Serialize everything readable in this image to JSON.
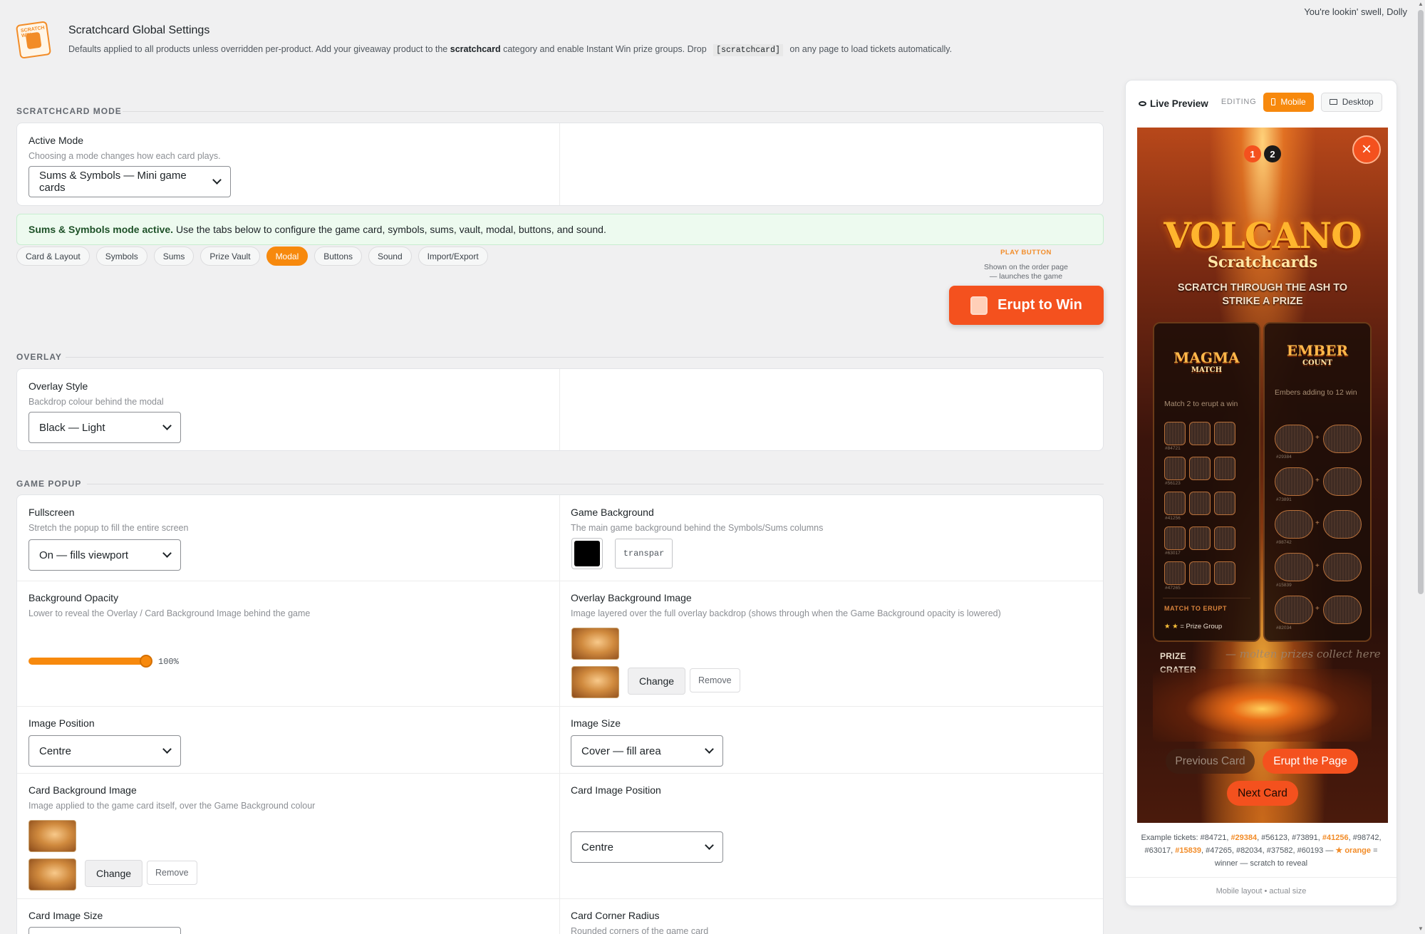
{
  "greeting": "You're lookin' swell, Dolly",
  "header": {
    "title": "Scratchcard Global Settings",
    "desc_part1": "Defaults applied to all products unless overridden per-product. Add your giveaway product to the",
    "desc_bold": "scratchcard",
    "desc_part2": "category and enable Instant Win prize groups. Drop",
    "desc_code": "[scratchcard]",
    "desc_part3": "on any page to load tickets automatically.",
    "logo_text": "SCRATCH WIN"
  },
  "mode_section": {
    "label": "SCRATCHCARD MODE",
    "active_mode_label": "Active Mode",
    "active_mode_help": "Choosing a mode changes how each card plays.",
    "active_mode_value": "Sums & Symbols — Mini game cards"
  },
  "notice": {
    "bold": "Sums & Symbols mode active.",
    "text": "Use the tabs below to configure the game card, symbols, sums, vault, modal, buttons, and sound."
  },
  "tabs": [
    {
      "label": "Card & Layout"
    },
    {
      "label": "Symbols"
    },
    {
      "label": "Sums"
    },
    {
      "label": "Prize Vault"
    },
    {
      "label": "Modal",
      "active": true
    },
    {
      "label": "Buttons"
    },
    {
      "label": "Sound"
    },
    {
      "label": "Import/Export"
    }
  ],
  "play_button": {
    "label": "PLAY BUTTON",
    "desc1": "Shown on the order page",
    "desc2": "— launches the game",
    "text": "Erupt to Win"
  },
  "overlay_section": {
    "label": "OVERLAY",
    "style_label": "Overlay Style",
    "style_help": "Backdrop colour behind the modal",
    "style_value": "Black — Light"
  },
  "popup_section": {
    "label": "GAME POPUP",
    "fullscreen_label": "Fullscreen",
    "fullscreen_help": "Stretch the popup to fill the entire screen",
    "fullscreen_value": "On — fills viewport",
    "bg_label": "Game Background",
    "bg_help": "The main game background behind the Symbols/Sums columns",
    "bg_color": "#000000",
    "bg_text": "transpar",
    "opacity_label": "Background Opacity",
    "opacity_help": "Lower to reveal the Overlay / Card Background Image behind the game",
    "opacity_value": "100%",
    "opacity_fraction": 1.0,
    "overlay_img_label": "Overlay Background Image",
    "overlay_img_help": "Image layered over the full overlay backdrop (shows through when the Game Background opacity is lowered)",
    "change_label": "Change",
    "remove_label": "Remove",
    "img_pos_label": "Image Position",
    "img_pos_value": "Centre",
    "img_size_label": "Image Size",
    "img_size_value": "Cover — fill area",
    "card_bg_label": "Card Background Image",
    "card_bg_help": "Image applied to the game card itself, over the Game Background colour",
    "card_img_pos_label": "Card Image Position",
    "card_img_pos_value": "Centre",
    "card_img_size_label": "Card Image Size",
    "corner_label": "Card Corner Radius",
    "corner_help": "Rounded corners of the game card"
  },
  "preview": {
    "title": "Live Preview",
    "editing": "EDITING",
    "mobile": "Mobile",
    "desktop": "Desktop",
    "step1": "1",
    "step2": "2",
    "close": "×",
    "game_title": "VOLCANO",
    "game_subtitle": "Scratchcards",
    "tagline": "SCRATCH THROUGH THE ASH TO STRIKE A PRIZE",
    "left_logo": "MAGMA",
    "left_logo_sub": "MATCH",
    "left_desc": "Match 2 to erupt a win",
    "right_logo": "EMBER",
    "right_logo_sub": "COUNT",
    "right_desc": "Embers adding to 12 win",
    "left_tickets": [
      "#84721",
      "#56123",
      "#41256",
      "#63017",
      "#47265"
    ],
    "right_tickets": [
      "#29384",
      "#73891",
      "#98742",
      "#15839",
      "#82034"
    ],
    "match_to_erupt": "MATCH TO ERUPT",
    "prize_group_stars": "★ ★",
    "prize_group": "= Prize Group",
    "crater_l1": "PRIZE",
    "crater_l2": "CRATER",
    "crater_r": "— molten prizes collect here",
    "prev_card": "Previous Card",
    "erupt_page": "Erupt the Page",
    "next_card": "Next Card",
    "examples_prefix": "Example tickets: #84721,",
    "ex_w1": "#29384",
    "ex_mid1": ", #56123, #73891,",
    "ex_w2": "#41256",
    "ex_mid2": ", #98742, #63017,",
    "ex_w3": "#15839",
    "ex_mid3": ", #47265, #82034, #37582, #60193 —",
    "ex_key": "★ orange",
    "ex_suffix": "= winner — scratch to reveal",
    "footer": "Mobile layout • actual size"
  },
  "colors": {
    "accent": "#f7890d",
    "cta": "#f4511e",
    "notice_bg": "#edfaef"
  }
}
